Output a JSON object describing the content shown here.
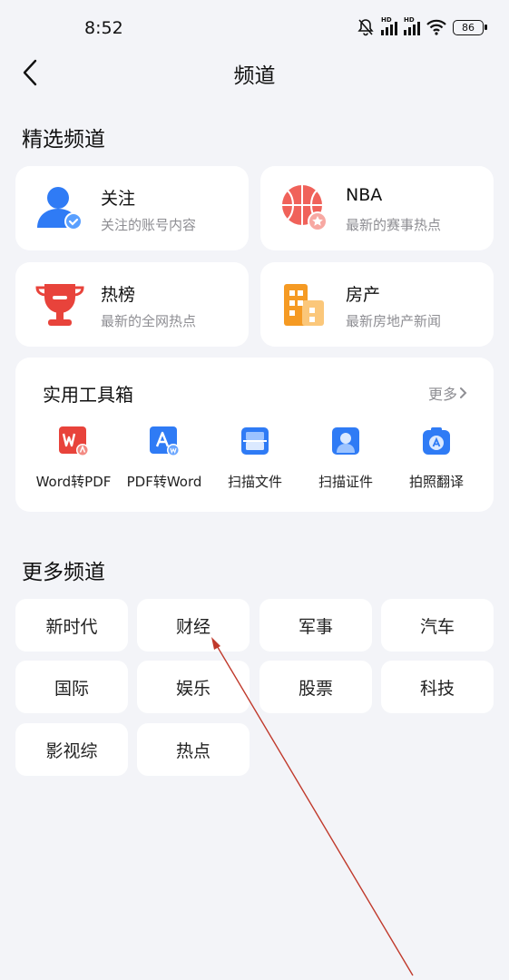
{
  "status_bar": {
    "time": "8:52",
    "battery": "86",
    "hd": "HD"
  },
  "header": {
    "title": "频道"
  },
  "featured": {
    "title": "精选频道",
    "items": [
      {
        "name": "关注",
        "desc": "关注的账号内容",
        "icon": "follow-user-icon"
      },
      {
        "name": "NBA",
        "desc": "最新的赛事热点",
        "icon": "basketball-icon"
      },
      {
        "name": "热榜",
        "desc": "最新的全网热点",
        "icon": "trophy-icon"
      },
      {
        "name": "房产",
        "desc": "最新房地产新闻",
        "icon": "building-icon"
      }
    ]
  },
  "toolbox": {
    "title": "实用工具箱",
    "more": "更多",
    "tools": [
      {
        "label": "Word转PDF",
        "icon": "word-to-pdf-icon"
      },
      {
        "label": "PDF转Word",
        "icon": "pdf-to-word-icon"
      },
      {
        "label": "扫描文件",
        "icon": "scan-file-icon"
      },
      {
        "label": "扫描证件",
        "icon": "scan-id-icon"
      },
      {
        "label": "拍照翻译",
        "icon": "photo-translate-icon"
      }
    ]
  },
  "more_channels": {
    "title": "更多频道",
    "items": [
      "新时代",
      "财经",
      "军事",
      "汽车",
      "国际",
      "娱乐",
      "股票",
      "科技",
      "影视综",
      "热点"
    ]
  },
  "colors": {
    "accent_blue": "#2f7bf5",
    "red": "#e8433b",
    "orange": "#f59a23",
    "background": "#f3f4f8"
  }
}
